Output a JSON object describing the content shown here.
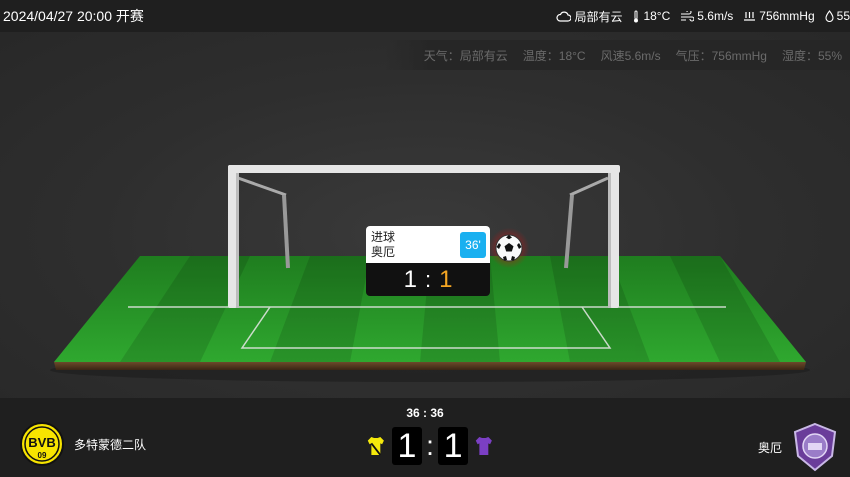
{
  "header": {
    "datetime": "2024/04/27 20:00 开赛",
    "weather": {
      "condition": "局部有云",
      "temperature": "18°C",
      "wind": "5.6m/s",
      "pressure": "756mmHg",
      "humidity": "55"
    }
  },
  "weather_bar": {
    "condition": "天气：局部有云",
    "temperature": "温度：18°C",
    "wind": "风速5.6m/s",
    "pressure": "气压：756mmHg",
    "humidity": "湿度：55%"
  },
  "event_popup": {
    "type": "进球",
    "team": "奥厄",
    "minute": "36'",
    "home_score": "1",
    "separator": ":",
    "away_score": "1"
  },
  "scoreboard": {
    "clock": "36 : 36",
    "home_team": "多特蒙德二队",
    "away_team": "奥厄",
    "home_score": "1",
    "separator": ":",
    "away_score": "1",
    "home_logo_text": "BVB",
    "home_logo_year": "09",
    "home_kit_color": "#f5e90b",
    "away_kit_color": "#7b3fc4"
  },
  "colors": {
    "goal_highlight": "#f5a623",
    "minute_badge": "#1ab0f0",
    "pitch_green": "#2a9a2a"
  }
}
